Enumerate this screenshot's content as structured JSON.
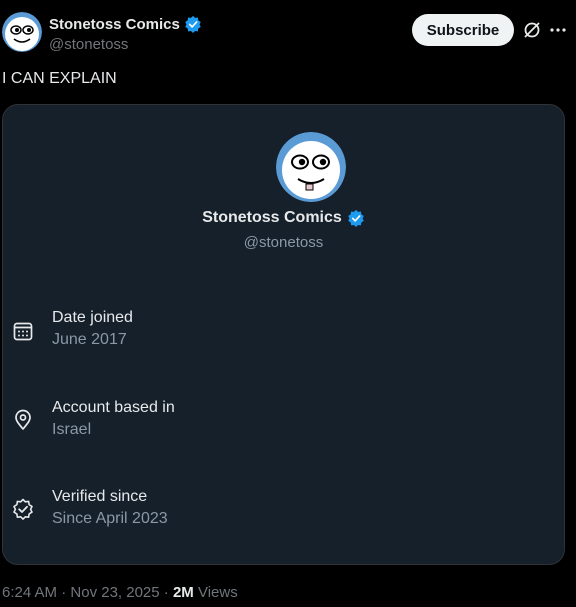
{
  "author": {
    "name": "Stonetoss Comics",
    "handle": "@stonetoss",
    "verified": true
  },
  "actions": {
    "subscribe_label": "Subscribe",
    "grok_icon": "grok-icon",
    "more_icon": "more-icon"
  },
  "tweet": {
    "text": "I CAN EXPLAIN"
  },
  "card": {
    "name": "Stonetoss Comics",
    "handle": "@stonetoss",
    "rows": [
      {
        "icon": "calendar-icon",
        "label": "Date joined",
        "value": "June 2017"
      },
      {
        "icon": "location-pin-icon",
        "label": "Account based in",
        "value": "Israel"
      },
      {
        "icon": "verified-badge-icon",
        "label": "Verified since",
        "value": "Since April 2023"
      }
    ]
  },
  "meta": {
    "time": "6:24 AM",
    "date": "Nov 23, 2025",
    "views_count": "2M",
    "views_label": "Views"
  },
  "colors": {
    "background": "#000000",
    "card_background": "#15202b",
    "verified_blue": "#1d9bf0",
    "subscribe_bg": "#eff3f4"
  }
}
